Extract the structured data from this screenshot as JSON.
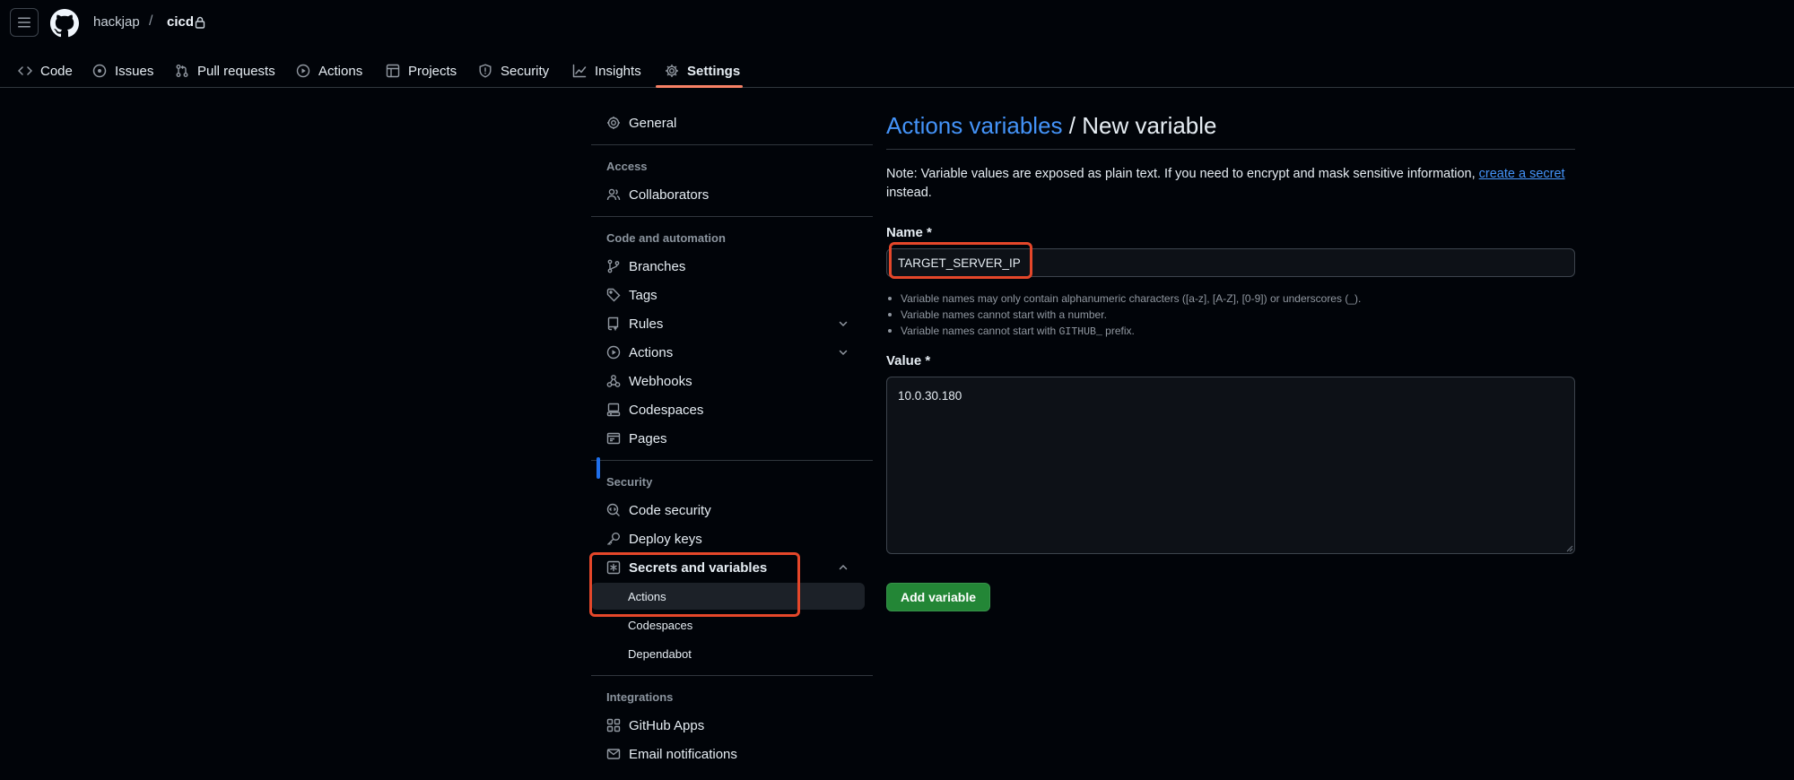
{
  "header": {
    "owner": "hackjap",
    "separator": "/",
    "repo": "cicd",
    "tabs": [
      {
        "label": "Code",
        "icon": "code-icon"
      },
      {
        "label": "Issues",
        "icon": "issue-opened-icon"
      },
      {
        "label": "Pull requests",
        "icon": "git-pull-request-icon"
      },
      {
        "label": "Actions",
        "icon": "play-icon"
      },
      {
        "label": "Projects",
        "icon": "table-icon"
      },
      {
        "label": "Security",
        "icon": "shield-icon"
      },
      {
        "label": "Insights",
        "icon": "graph-icon"
      },
      {
        "label": "Settings",
        "icon": "gear-icon",
        "active": true
      }
    ]
  },
  "sidebar": {
    "general": "General",
    "access_heading": "Access",
    "collaborators": "Collaborators",
    "code_automation_heading": "Code and automation",
    "branches": "Branches",
    "tags": "Tags",
    "rules": "Rules",
    "actions": "Actions",
    "webhooks": "Webhooks",
    "codespaces": "Codespaces",
    "pages": "Pages",
    "security_heading": "Security",
    "code_security": "Code security",
    "deploy_keys": "Deploy keys",
    "secrets_and_variables": "Secrets and variables",
    "sub_actions": "Actions",
    "sub_codespaces": "Codespaces",
    "sub_dependabot": "Dependabot",
    "integrations_heading": "Integrations",
    "github_apps": "GitHub Apps",
    "email_notifications": "Email notifications"
  },
  "main": {
    "title_link": "Actions variables",
    "title_sep": " / ",
    "title_rest": "New variable",
    "note_before": "Note: Variable values are exposed as plain text. If you need to encrypt and mask sensitive information, ",
    "note_link": "create a secret",
    "note_after": " instead.",
    "name_label": "Name *",
    "name_value": "TARGET_SERVER_IP",
    "rule_1": "Variable names may only contain alphanumeric characters ([a-z], [A-Z], [0-9]) or underscores (_).",
    "rule_2": "Variable names cannot start with a number.",
    "rule_3_before": "Variable names cannot start with ",
    "rule_3_code": "GITHUB_",
    "rule_3_after": " prefix.",
    "value_label": "Value *",
    "value_value": "10.0.30.180",
    "add_button": "Add variable"
  },
  "colors": {
    "background": "#010409",
    "accent_link": "#4493f8",
    "primary_button": "#238636",
    "active_tab_underline": "#f78166",
    "highlight_annotation": "#e5472a"
  }
}
